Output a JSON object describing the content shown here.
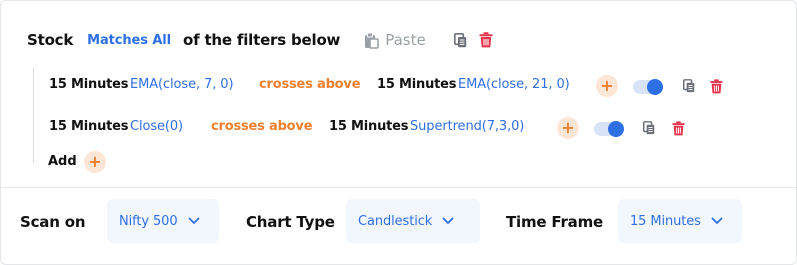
{
  "header": {
    "stock_label": "Stock",
    "matches_label": "Matches All",
    "filters_label": "of the filters below",
    "paste_label": "Paste"
  },
  "filters": [
    {
      "left_timeframe": "15 Minutes",
      "left_indicator": "EMA(close, 7, 0)",
      "condition": "crosses above",
      "right_timeframe": "15 Minutes",
      "right_indicator": "EMA(close, 21, 0)",
      "enabled": true
    },
    {
      "left_timeframe": "15 Minutes",
      "left_indicator": "Close(0)",
      "condition": "crosses above",
      "right_timeframe": "15 Minutes",
      "right_indicator": "Supertrend(7,3,0)",
      "enabled": true
    }
  ],
  "add_label": "Add",
  "plus_symbol": "+",
  "footer": {
    "scan_on_label": "Scan on",
    "scan_on_value": "Nifty 500",
    "chart_type_label": "Chart Type",
    "chart_type_value": "Candlestick",
    "time_frame_label": "Time Frame",
    "time_frame_value": "15 Minutes"
  },
  "colors": {
    "accent_blue": "#2f6fe4",
    "condition_orange": "#f07f2e",
    "delete_red": "#e5344b",
    "muted_gray": "#9aa0a6"
  },
  "icons": {
    "paste": "clipboard-icon",
    "copy": "copy-icon",
    "delete": "trash-icon",
    "chevron": "chevron-down-icon"
  }
}
